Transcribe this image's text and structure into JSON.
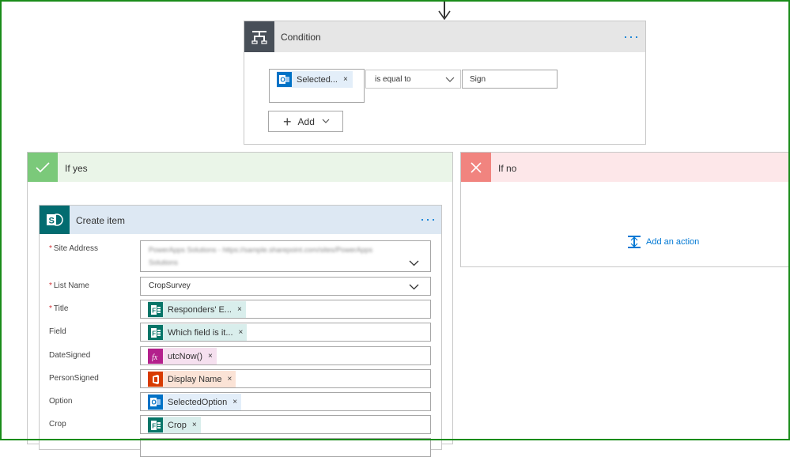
{
  "condition": {
    "title": "Condition",
    "more_label": "···",
    "left_token": {
      "label": "Selected...",
      "icon": "outlook-icon",
      "remove": "×"
    },
    "operator": "is equal to",
    "value": "Sign",
    "add_label": "Add"
  },
  "if_yes": {
    "title": "If yes",
    "create_item": {
      "title": "Create item",
      "more_label": "···",
      "fields": [
        {
          "label": "Site Address",
          "required": true,
          "value": ""
        },
        {
          "label": "List Name",
          "required": true,
          "value": "CropSurvey"
        },
        {
          "label": "Title",
          "required": true,
          "token": "Responders' E...",
          "icon": "forms-icon"
        },
        {
          "label": "Field",
          "required": false,
          "token": "Which field is it...",
          "icon": "forms-icon"
        },
        {
          "label": "DateSigned",
          "required": false,
          "token": "utcNow()",
          "icon": "expression-icon"
        },
        {
          "label": "PersonSigned",
          "required": false,
          "token": "Display Name",
          "icon": "office365-icon"
        },
        {
          "label": "Option",
          "required": false,
          "token": "SelectedOption",
          "icon": "outlook-icon"
        },
        {
          "label": "Crop",
          "required": false,
          "token": "Crop",
          "icon": "forms-icon"
        }
      ],
      "required_mark": "*",
      "remove_mark": "×"
    }
  },
  "if_no": {
    "title": "If no",
    "add_action_label": "Add an action"
  },
  "colors": {
    "frame": "#1a8c1a",
    "accent": "#0078d4",
    "yes": "#7bc97a",
    "no": "#f1847f",
    "sharepoint": "#036c70",
    "forms": "#077568",
    "expression": "#b3208c",
    "office": "#d83b01"
  }
}
